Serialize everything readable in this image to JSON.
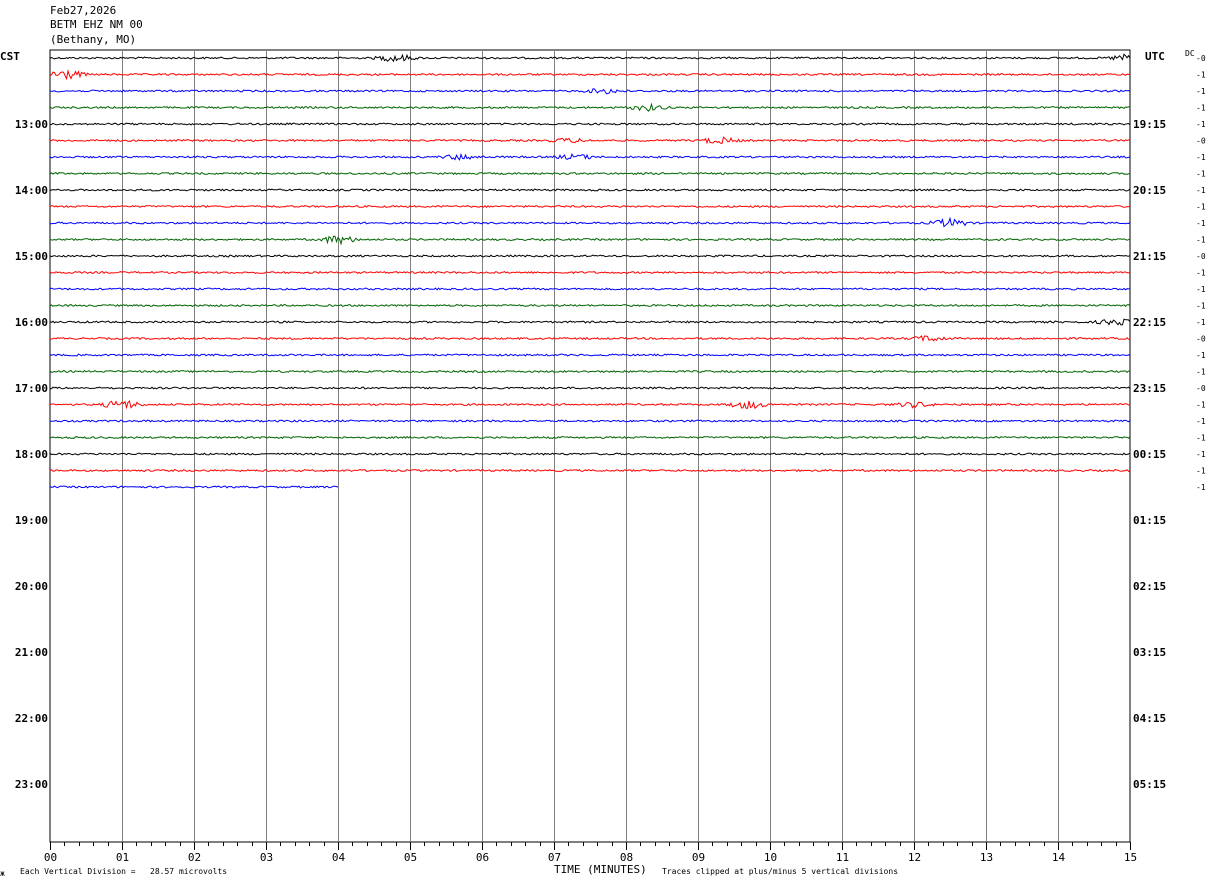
{
  "header": {
    "date": "Feb27,2026",
    "station": "BETM EHZ NM 00",
    "location": "(Bethany, MO)"
  },
  "left_timezone": "CST",
  "right_timezone": "UTC",
  "dc_label": "DC",
  "footer": {
    "scale_text": "Each Vertical Division =   28.57 microvolts",
    "axis_title": "TIME (MINUTES)",
    "clip_text": "Traces clipped at plus/minus 5 vertical divisions",
    "corner_mark": "ж"
  },
  "colors": {
    "trace_cycle": [
      "#000000",
      "#ff0000",
      "#0000ff",
      "#006400"
    ],
    "grid": "#808080"
  },
  "chart_data": {
    "type": "line",
    "title": "BETM EHZ NM 00",
    "xlabel": "TIME (MINUTES)",
    "xlim": [
      0,
      15
    ],
    "x_ticks": [
      "00",
      "01",
      "02",
      "03",
      "04",
      "05",
      "06",
      "07",
      "08",
      "09",
      "10",
      "11",
      "12",
      "13",
      "14",
      "15"
    ],
    "left_hour_labels": [
      "13:00",
      "14:00",
      "15:00",
      "16:00",
      "17:00",
      "18:00",
      "19:00",
      "20:00",
      "21:00",
      "22:00",
      "23:00"
    ],
    "right_hour_labels": [
      "19:15",
      "20:15",
      "21:15",
      "22:15",
      "23:15",
      "00:15",
      "01:15",
      "02:15",
      "03:15",
      "04:15",
      "05:15"
    ],
    "rows_per_hour": 4,
    "minutes_per_row": 15,
    "first_row_minutes_before_first_label": 60,
    "dc_offsets": [
      "-0",
      "-1",
      "-1",
      "-1",
      "-1",
      "-0",
      "-1",
      "-1",
      "-1",
      "-1",
      "-1",
      "-1",
      "-0",
      "-1",
      "-1",
      "-1",
      "-1",
      "-0",
      "-1",
      "-1",
      "-0",
      "-1",
      "-1",
      "-1",
      "-1",
      "-1",
      "-1"
    ],
    "trace_count": 27,
    "last_trace_end_minute": 4,
    "events": [
      {
        "row": 0,
        "minute": 4.8,
        "amp": 3.5
      },
      {
        "row": 0,
        "minute": 15.0,
        "amp": 4
      },
      {
        "row": 1,
        "minute": 0.2,
        "amp": 5
      },
      {
        "row": 2,
        "minute": 7.7,
        "amp": 2.5
      },
      {
        "row": 3,
        "minute": 8.3,
        "amp": 3
      },
      {
        "row": 6,
        "minute": 7.3,
        "amp": 2.5
      },
      {
        "row": 5,
        "minute": 7.2,
        "amp": 2
      },
      {
        "row": 5,
        "minute": 9.3,
        "amp": 3
      },
      {
        "row": 6,
        "minute": 5.7,
        "amp": 2.5
      },
      {
        "row": 10,
        "minute": 12.5,
        "amp": 4
      },
      {
        "row": 11,
        "minute": 4.0,
        "amp": 4
      },
      {
        "row": 16,
        "minute": 14.8,
        "amp": 3
      },
      {
        "row": 17,
        "minute": 12.2,
        "amp": 2.5
      },
      {
        "row": 21,
        "minute": 1.0,
        "amp": 4.5
      },
      {
        "row": 21,
        "minute": 9.7,
        "amp": 4
      },
      {
        "row": 21,
        "minute": 12.0,
        "amp": 2.5
      }
    ],
    "grid": true
  }
}
